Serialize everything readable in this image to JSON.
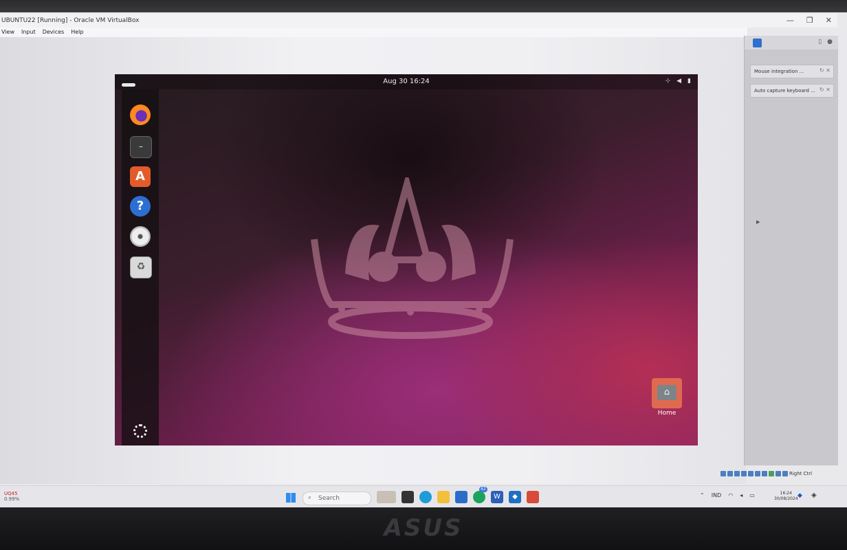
{
  "vbox": {
    "title": "UBUNTU22 [Running] - Oracle VM VirtualBox",
    "menus": [
      "View",
      "Input",
      "Devices",
      "Help"
    ],
    "window_controls": [
      "—",
      "❐",
      "✕"
    ],
    "side_panel": {
      "rows": [
        {
          "label": "Mouse integration ...",
          "controls": "↻ ✕"
        },
        {
          "label": "Auto capture keyboard ...",
          "controls": "↻ ✕"
        }
      ]
    },
    "status_host_key": "Right Ctrl"
  },
  "guest": {
    "clock": "Aug 30  16:24",
    "tray_icons": [
      "network-icon",
      "volume-icon",
      "battery-icon"
    ],
    "dock": [
      "firefox-icon",
      "terminal-icon",
      "software-store-icon",
      "help-icon",
      "disc-icon",
      "trash-icon"
    ],
    "desktop_icons": [
      {
        "label": "Home",
        "icon": "home-folder-icon"
      }
    ]
  },
  "taskbar": {
    "weather_temp": "UQ45",
    "weather_sub": "0.99%",
    "search_placeholder": "Search",
    "whatsapp_badge": "42",
    "language": "IND",
    "time": "16:24",
    "date": "30/08/2024"
  },
  "monitor": {
    "brand": "ASUS"
  }
}
